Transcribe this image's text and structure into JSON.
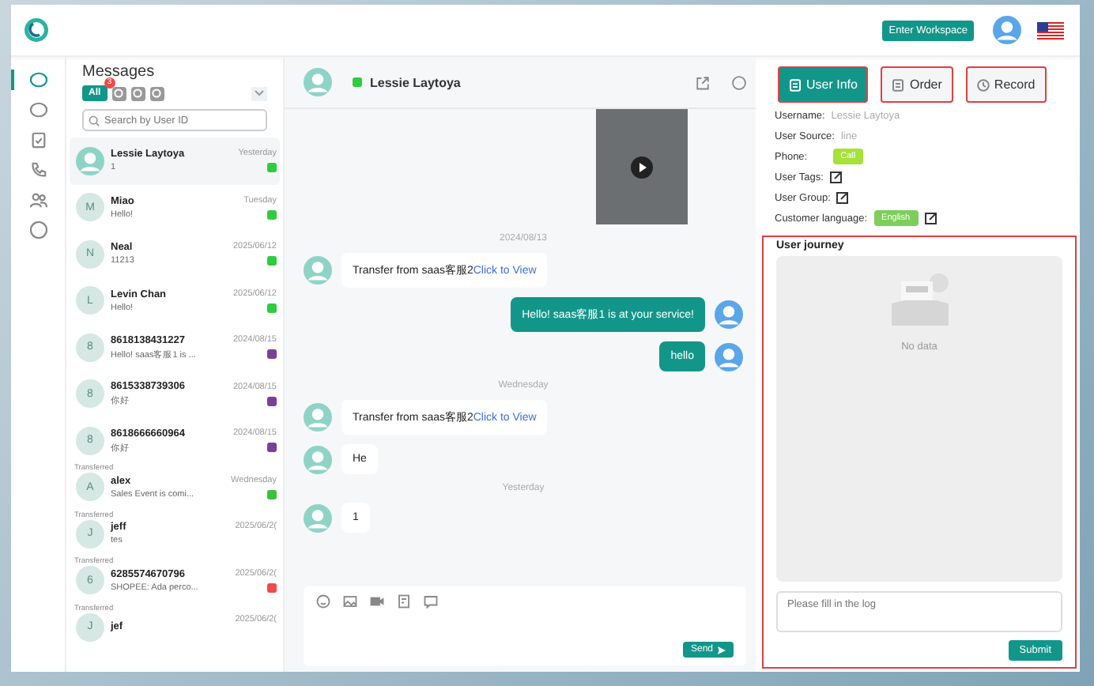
{
  "header": {
    "workspace_button": "Enter Workspace"
  },
  "nav": [
    {
      "selected": true
    },
    {
      "selected": false
    },
    {
      "selected": false
    },
    {
      "selected": false
    },
    {
      "selected": false
    },
    {
      "selected": false
    }
  ],
  "messages": {
    "title": "Messages",
    "filters": [
      {
        "label": "All",
        "selected": true,
        "badge": "3"
      },
      {
        "selected": false
      },
      {
        "selected": false
      },
      {
        "selected": false
      }
    ],
    "search": {
      "placeholder": "Search by User ID"
    },
    "items": [
      {
        "name": "Lessie Laytoya",
        "preview": "1",
        "time": "Yesterday",
        "color": "#2ecc40",
        "selected": true
      },
      {
        "initial": "M",
        "name": "Miao",
        "preview": "Hello!",
        "time": "Tuesday",
        "color": "#2ecc40",
        "selected": false
      },
      {
        "initial": "N",
        "name": "Neal",
        "preview": "11213",
        "time": "2025/06/12",
        "color": "#2ecc40",
        "selected": false
      },
      {
        "initial": "L",
        "name": "Levin Chan",
        "preview": "Hello!",
        "time": "2025/06/12",
        "color": "#2ecc40",
        "selected": false
      },
      {
        "initial": "8",
        "name": "8618138431227",
        "preview": "Hello! saas客服1 is ...",
        "time": "2024/08/15",
        "color": "#7b3f98",
        "selected": false
      },
      {
        "initial": "8",
        "name": "8615338739306",
        "preview": "你好",
        "time": "2024/08/15",
        "color": "#7b3f98",
        "selected": false
      },
      {
        "initial": "8",
        "name": "8618666660964",
        "preview": "你好",
        "time": "2024/08/15",
        "color": "#7b3f98",
        "selected": false
      },
      {
        "initial": "A",
        "name": "alex",
        "preview": "Sales Event is comi...",
        "time": "Wednesday",
        "color": "#3cc13b",
        "selected": false,
        "stamp": "Transferred"
      },
      {
        "initial": "J",
        "name": "jeff",
        "preview": "tes",
        "time": "2025/06/2(",
        "selected": false,
        "stamp": "Transferred"
      },
      {
        "initial": "6",
        "name": "6285574670796",
        "preview": "SHOPEE: Ada perco...",
        "time": "2025/06/2(",
        "color": "#f04a4a",
        "selected": false,
        "stamp": "Transferred"
      },
      {
        "initial": "J",
        "name": "jef",
        "time": "2025/06/2(",
        "selected": false,
        "stamp": "Transferred"
      }
    ]
  },
  "chat": {
    "contact": "Lessie Laytoya",
    "entries": [
      {
        "kind": "video"
      },
      {
        "kind": "date",
        "text": "2024/08/13"
      },
      {
        "kind": "incoming",
        "text": "Transfer from saas客服2",
        "link": "Click to View"
      },
      {
        "kind": "outgoing",
        "text": "Hello! saas客服1 is at your service!"
      },
      {
        "kind": "outgoing",
        "text": "hello"
      },
      {
        "kind": "date",
        "text": "Wednesday"
      },
      {
        "kind": "incoming",
        "text": "Transfer from saas客服2",
        "link": "Click to View"
      },
      {
        "kind": "incoming",
        "text": "He"
      },
      {
        "kind": "date",
        "text": "Yesterday"
      },
      {
        "kind": "incoming",
        "text": "1"
      }
    ],
    "send_button": "Send"
  },
  "panel": {
    "tabs": [
      {
        "label": "User Info",
        "selected": true,
        "highlighted": true
      },
      {
        "label": "Order",
        "selected": false,
        "highlighted": true
      },
      {
        "label": "Record",
        "selected": false,
        "highlighted": true
      }
    ],
    "fields": [
      {
        "kind": "text",
        "label": "Username:",
        "value": "Lessie Laytoya"
      },
      {
        "kind": "text",
        "label": "User Source:",
        "value": "line"
      },
      {
        "kind": "tag",
        "label": "Phone:",
        "value": "Call",
        "color": "#a6e23a"
      },
      {
        "kind": "edit",
        "label": "User Tags:"
      },
      {
        "kind": "edit",
        "label": "User Group:"
      },
      {
        "kind": "tag-edit",
        "label": "Customer language:",
        "value": "English",
        "color": "#7ccf5a"
      }
    ],
    "journey": {
      "title": "User journey",
      "highlighted": true,
      "empty_text": "No data",
      "log": {
        "placeholder": "Please fill in the log"
      },
      "submit_button": "Submit"
    }
  }
}
